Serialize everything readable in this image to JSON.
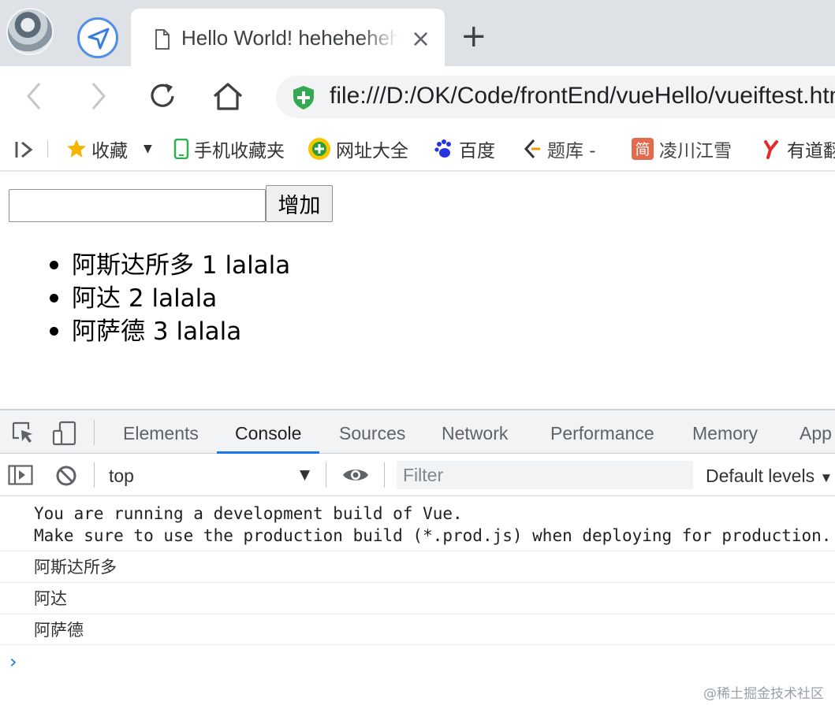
{
  "browser": {
    "tab_title": "Hello World! hehehehehe",
    "tab_close": "×",
    "new_tab": "+",
    "url": "file:///D:/OK/Code/frontEnd/vueHello/vueiftest.html",
    "icons": [
      "profile-avatar",
      "navigation-extension-icon",
      "page-icon",
      "back-icon",
      "forward-icon",
      "reload-icon",
      "home-icon",
      "secure-shield-icon"
    ]
  },
  "bookmarks": {
    "items": [
      {
        "label": "收藏",
        "icon": "star-icon"
      },
      {
        "label": "手机收藏夹",
        "icon": "phone-icon"
      },
      {
        "label": "网址大全",
        "icon": "plus-globe-icon"
      },
      {
        "label": "百度",
        "icon": "baidu-paw-icon"
      },
      {
        "label": "题库 -",
        "icon": "tiku-icon"
      },
      {
        "label": "凌川江雪",
        "icon": "jian-icon"
      },
      {
        "label": "有道翻",
        "icon": "youdao-icon"
      }
    ]
  },
  "page": {
    "input_value": "",
    "add_button": "增加",
    "items": [
      {
        "name": "阿斯达所多",
        "id": "1",
        "suffix": "lalala"
      },
      {
        "name": "阿达",
        "id": "2",
        "suffix": "lalala"
      },
      {
        "name": "阿萨德",
        "id": "3",
        "suffix": "lalala"
      }
    ]
  },
  "devtools": {
    "tabs": [
      "Elements",
      "Console",
      "Sources",
      "Network",
      "Performance",
      "Memory",
      "App"
    ],
    "active_tab": "Console",
    "context": "top",
    "filter_placeholder": "Filter",
    "levels": "Default levels",
    "console": {
      "vue_warning_line1": "You are running a development build of Vue.",
      "vue_warning_line2": "Make sure to use the production build (*.prod.js) when deploying for production.",
      "logs": [
        "阿斯达所多",
        "阿达",
        "阿萨德"
      ],
      "prompt": "›"
    }
  },
  "watermark": "@稀土掘金技术社区",
  "colors": {
    "accent": "#1a73e8",
    "tabstrip": "#dee1e6",
    "shield": "#34a853"
  }
}
